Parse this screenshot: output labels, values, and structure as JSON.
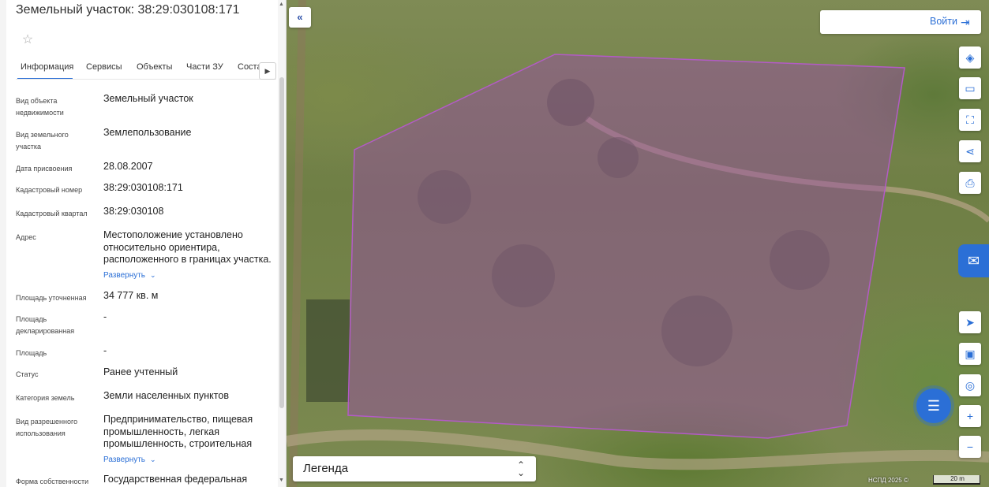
{
  "panel": {
    "title": "Земельный участок: 38:29:030108:171",
    "favorite_icon": "star-icon",
    "tabs": [
      "Информация",
      "Сервисы",
      "Объекты",
      "Части ЗУ",
      "Соста"
    ],
    "tabs_next_icon": "chevron-right-icon",
    "expand_label": "Развернуть",
    "fields": [
      {
        "label": "Вид объекта недвижимости",
        "value": "Земельный участок"
      },
      {
        "label": "Вид земельного участка",
        "value": "Землепользование"
      },
      {
        "label": "Дата присвоения",
        "value": "28.08.2007"
      },
      {
        "label": "Кадастровый номер",
        "value": "38:29:030108:171"
      },
      {
        "label": "Кадастровый квартал",
        "value": "38:29:030108"
      },
      {
        "label": "Адрес",
        "value": "Местоположение установлено относительно ориентира, расположенного в границах участка."
      },
      {
        "label": "Площадь уточненная",
        "value": "34 777 кв. м"
      },
      {
        "label": "Площадь декларированная",
        "value": "-"
      },
      {
        "label": "Площадь",
        "value": "-"
      },
      {
        "label": "Статус",
        "value": "Ранее учтенный"
      },
      {
        "label": "Категория земель",
        "value": "Земли населенных пунктов"
      },
      {
        "label": "Вид разрешенного использования",
        "value": "Предпринимательство, пищевая промышленность, легкая промышленность, строительная"
      },
      {
        "label": "Форма собственности",
        "value": "Государственная федеральная"
      }
    ]
  },
  "map": {
    "collapse_icon": "double-chevron-left-icon",
    "login_label": "Войти",
    "login_icon": "login-icon",
    "buttons": [
      "layers-icon",
      "ruler-icon",
      "select-area-icon",
      "share-icon",
      "print-icon",
      "navigate-icon",
      "minimap-icon",
      "location-pin-icon",
      "zoom-in-icon",
      "zoom-out-icon"
    ],
    "legend_label": "Легенда",
    "attribution": "НСПД 2025 ©",
    "scale_label": "20 m",
    "parcel_color": "#a64ab8"
  }
}
